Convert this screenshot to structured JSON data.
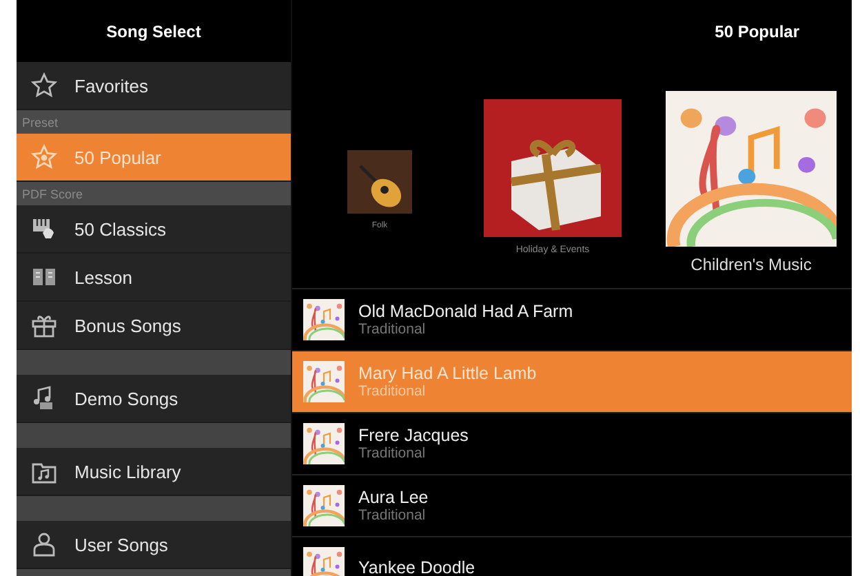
{
  "sidebar": {
    "title": "Song Select",
    "items": [
      {
        "kind": "item",
        "label": "Favorites",
        "selected": false
      },
      {
        "kind": "header",
        "label": "Preset"
      },
      {
        "kind": "item",
        "label": "50 Popular",
        "selected": true
      },
      {
        "kind": "header",
        "label": "PDF Score"
      },
      {
        "kind": "item",
        "label": "50 Classics",
        "selected": false
      },
      {
        "kind": "item",
        "label": "Lesson",
        "selected": false
      },
      {
        "kind": "item",
        "label": "Bonus Songs",
        "selected": false
      },
      {
        "kind": "gap"
      },
      {
        "kind": "item",
        "label": "Demo Songs",
        "selected": false
      },
      {
        "kind": "gap"
      },
      {
        "kind": "item",
        "label": "Music Library",
        "selected": false
      },
      {
        "kind": "gap"
      },
      {
        "kind": "item",
        "label": "User Songs",
        "selected": false
      },
      {
        "kind": "gap"
      }
    ]
  },
  "main": {
    "title": "50 Popular",
    "categories": [
      {
        "label": "Folk"
      },
      {
        "label": "Holiday & Events"
      },
      {
        "label": "Children's Music"
      }
    ],
    "songs": [
      {
        "title": "Old MacDonald Had A Farm",
        "artist": "Traditional",
        "selected": false
      },
      {
        "title": "Mary Had A Little Lamb",
        "artist": "Traditional",
        "selected": true
      },
      {
        "title": "Frere Jacques",
        "artist": "Traditional",
        "selected": false
      },
      {
        "title": "Aura Lee",
        "artist": "Traditional",
        "selected": false
      },
      {
        "title": "Yankee Doodle",
        "selected": false
      }
    ]
  }
}
